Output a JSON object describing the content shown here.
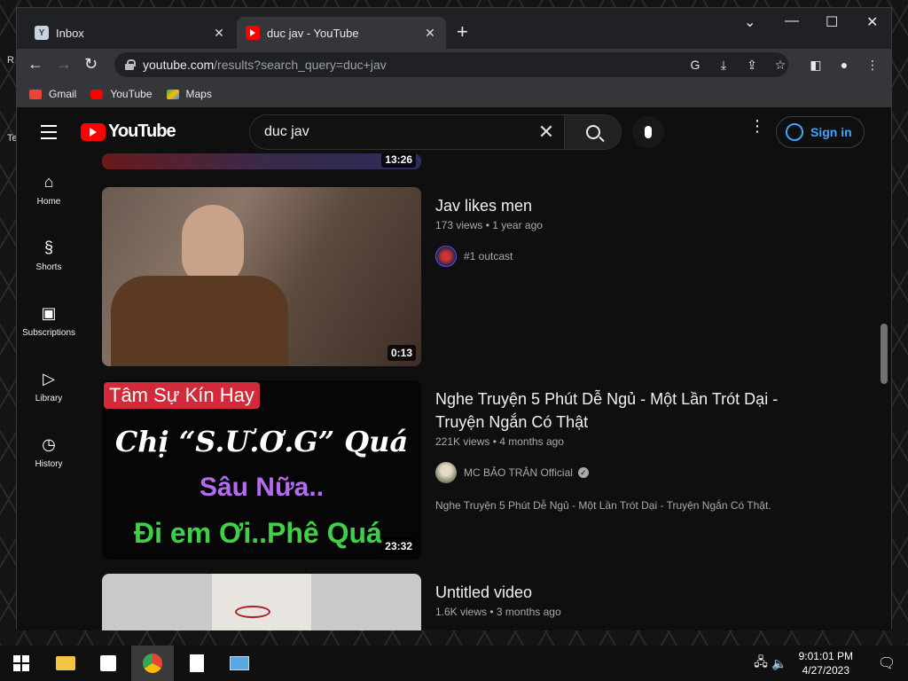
{
  "desktop": {
    "left_label_1": "R",
    "left_label_2": "Te"
  },
  "browser": {
    "tabs": [
      {
        "title": "Inbox",
        "icon": "yahoo-icon"
      },
      {
        "title": "duc jav - YouTube",
        "icon": "youtube-icon",
        "active": true
      }
    ],
    "new_tab": "+",
    "url_host": "youtube.com",
    "url_path": "/results?search_query=duc+jav",
    "bookmarks": [
      {
        "label": "Gmail",
        "icon": "gmail-icon"
      },
      {
        "label": "YouTube",
        "icon": "youtube-icon"
      },
      {
        "label": "Maps",
        "icon": "maps-icon"
      }
    ]
  },
  "youtube": {
    "logo_text": "YouTube",
    "search_query": "duc jav",
    "signin_label": "Sign in",
    "sidebar": [
      {
        "label": "Home",
        "icon": "home-icon"
      },
      {
        "label": "Shorts",
        "icon": "shorts-icon"
      },
      {
        "label": "Subscriptions",
        "icon": "subscriptions-icon"
      },
      {
        "label": "Library",
        "icon": "library-icon"
      },
      {
        "label": "History",
        "icon": "history-icon"
      }
    ],
    "results": [
      {
        "duration": "13:26"
      },
      {
        "title": "Jav likes men",
        "views": "173 views",
        "age": "1 year ago",
        "channel": "#1 outcast",
        "duration": "0:13"
      },
      {
        "title_line1": "Nghe Truyện 5 Phút Dễ Ngủ - Một Lần Trót Dại -",
        "title_line2": "Truyện Ngắn Có Thật",
        "views": "221K views",
        "age": "4 months ago",
        "channel": "MC BẢO TRÂN Official",
        "description": "Nghe Truyện 5 Phút Dễ Ngủ - Một Lần Trót Dại - Truyện Ngắn Có Thật.",
        "duration": "23:32",
        "thumb_badge": "Tâm Sự Kín Hay",
        "thumb_line1": "Chị “S.Ư.Ơ.G” Quá",
        "thumb_line2": "Sâu Nữa..",
        "thumb_line3": "Đi em Ơi..Phê Quá"
      },
      {
        "title": "Untitled video",
        "views": "1.6K views",
        "age": "3 months ago"
      }
    ]
  },
  "taskbar": {
    "time": "9:01:01 PM",
    "date": "4/27/2023"
  }
}
